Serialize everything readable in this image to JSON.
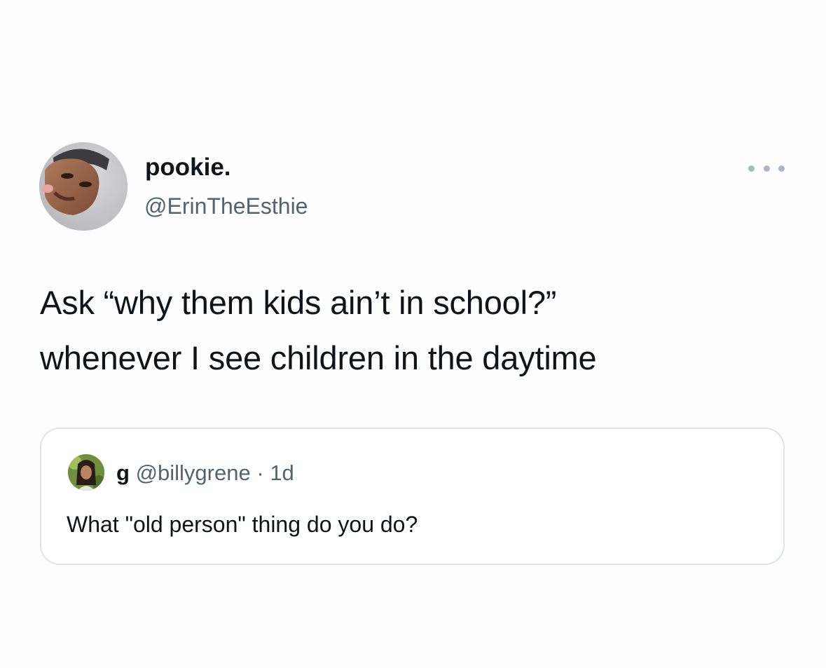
{
  "tweet": {
    "display_name": "pookie.",
    "handle": "@ErinTheEsthie",
    "text": "Ask “why them kids ain’t in school?”\nwhenever I see children in the daytime",
    "more_icon": "more-horizontal-icon",
    "avatar": "profile-photo"
  },
  "quoted_tweet": {
    "display_name": "g",
    "handle": "@billygrene",
    "separator": "·",
    "time": "1d",
    "text": "What \"old person\" thing do you do?",
    "avatar": "profile-photo"
  },
  "colors": {
    "background": "#fdfdfd",
    "text_primary": "#0f1419",
    "text_secondary": "#536471",
    "border": "#dfe3e6",
    "more_dots": "#aab8c2"
  }
}
